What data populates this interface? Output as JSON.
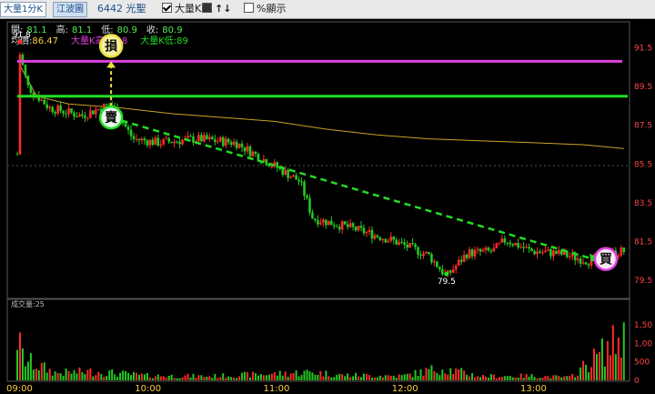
{
  "toolbar": {
    "tab1": "大量1分K",
    "tab2": "江波圖",
    "stock": "6442 光聖",
    "opt_bigk": "大量K",
    "opt_icons": "↑↓",
    "opt_pct": "%顯示"
  },
  "info": {
    "open_label": "開:",
    "open": "81.1",
    "high_label": "高:",
    "high": "81.1",
    "low_label": "低:",
    "low": "80.9",
    "close_label": "收:",
    "close": "80.9",
    "avg_label": "均價:",
    "avg": "86.47",
    "bighigh_label": "大量K高:",
    "bighigh": "90.8",
    "biglow_label": "大量K低:",
    "biglow": "89"
  },
  "volume_label": "成交量:25",
  "signals": {
    "stop": "損",
    "sell": "賣",
    "buy": "買"
  },
  "annotations": {
    "high": "91.8",
    "low": "79.5"
  },
  "colors": {
    "up": "#ff2a2a",
    "down": "#22c922",
    "avg": "#c9a227",
    "magenta": "#e040e0",
    "green": "#22dd22",
    "axis": "#ff4444",
    "time": "#ffd040"
  },
  "chart_data": {
    "type": "candlestick",
    "price_axis": {
      "ticks": [
        "91.5",
        "89.5",
        "87.5",
        "85.5",
        "83.5",
        "81.5",
        "79.5"
      ],
      "range": [
        78.8,
        92.6
      ]
    },
    "volume_axis": {
      "ticks": [
        "1,50",
        "1,00",
        "500",
        "0"
      ],
      "max": 1600
    },
    "time_labels": [
      "09:00",
      "10:00",
      "11:00",
      "12:00",
      "13:00"
    ],
    "reference_price": 86.0,
    "horizontal_lines": [
      {
        "name": "大量K高",
        "value": 90.8
      },
      {
        "name": "大量K低",
        "value": 89
      }
    ],
    "sell_signal_price": 87.9,
    "buy_signal_price": 80.6,
    "trend_line": {
      "from": [
        0.73,
        87.9
      ],
      "to": [
        4.58,
        80.6
      ]
    },
    "high_point": {
      "x": 0.02,
      "y": 91.8
    },
    "low_point": {
      "x": 3.34,
      "y": 79.5
    },
    "price_path": [
      [
        0,
        86
      ],
      [
        0.02,
        91.2
      ],
      [
        0.08,
        89.5
      ],
      [
        0.25,
        88.4
      ],
      [
        0.5,
        88.0
      ],
      [
        0.73,
        88.6
      ],
      [
        0.9,
        86.8
      ],
      [
        1.1,
        86.6
      ],
      [
        1.4,
        86.8
      ],
      [
        1.7,
        86.6
      ],
      [
        1.85,
        86.0
      ],
      [
        2.05,
        85.2
      ],
      [
        2.2,
        84.6
      ],
      [
        2.3,
        82.7
      ],
      [
        2.6,
        82.2
      ],
      [
        2.9,
        81.6
      ],
      [
        3.2,
        80.8
      ],
      [
        3.34,
        79.7
      ],
      [
        3.5,
        80.9
      ],
      [
        3.7,
        81.0
      ],
      [
        3.8,
        81.6
      ],
      [
        4.0,
        81.0
      ],
      [
        4.2,
        80.9
      ],
      [
        4.45,
        80.5
      ],
      [
        4.6,
        80.8
      ],
      [
        4.7,
        81.0
      ]
    ],
    "avg_path": [
      [
        0.02,
        90.6
      ],
      [
        0.15,
        89.0
      ],
      [
        0.4,
        88.6
      ],
      [
        0.8,
        88.4
      ],
      [
        1.2,
        88.1
      ],
      [
        1.6,
        87.9
      ],
      [
        2.0,
        87.7
      ],
      [
        2.4,
        87.3
      ],
      [
        2.8,
        87.0
      ],
      [
        3.2,
        86.8
      ],
      [
        3.6,
        86.7
      ],
      [
        4.0,
        86.6
      ],
      [
        4.4,
        86.5
      ],
      [
        4.72,
        86.3
      ]
    ],
    "volume_profile": [
      [
        0,
        1450
      ],
      [
        0.05,
        700
      ],
      [
        0.3,
        250
      ],
      [
        0.6,
        300
      ],
      [
        1.0,
        160
      ],
      [
        1.5,
        140
      ],
      [
        2.0,
        220
      ],
      [
        2.3,
        280
      ],
      [
        2.5,
        180
      ],
      [
        3.0,
        150
      ],
      [
        3.3,
        420
      ],
      [
        3.6,
        140
      ],
      [
        4.0,
        150
      ],
      [
        4.3,
        100
      ],
      [
        4.7,
        1450
      ]
    ]
  }
}
